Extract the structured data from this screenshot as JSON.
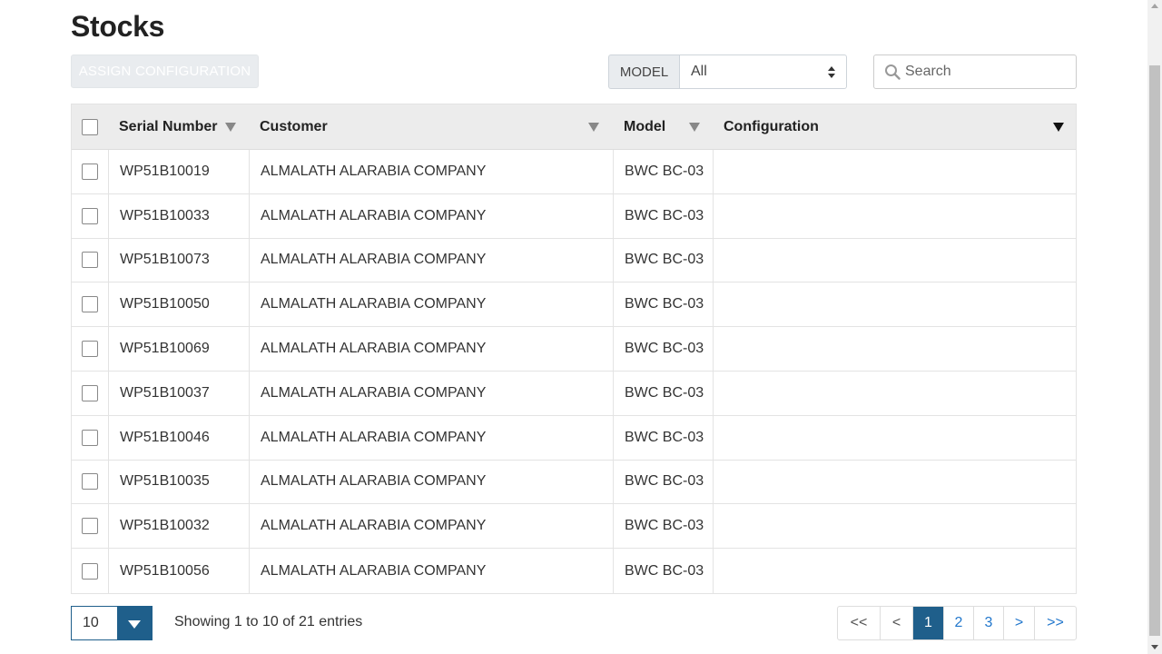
{
  "page": {
    "title": "Stocks"
  },
  "toolbar": {
    "assign_label": "ASSIGN CONFIGURATION",
    "model_label": "MODEL",
    "model_selected": "All",
    "search_placeholder": "Search"
  },
  "table": {
    "headers": [
      "Serial Number",
      "Customer",
      "Model",
      "Configuration"
    ],
    "rows": [
      {
        "serial": "WP51B10019",
        "customer": "ALMALATH ALARABIA COMPANY",
        "model": "BWC BC-03",
        "configuration": ""
      },
      {
        "serial": "WP51B10033",
        "customer": "ALMALATH ALARABIA COMPANY",
        "model": "BWC BC-03",
        "configuration": ""
      },
      {
        "serial": "WP51B10073",
        "customer": "ALMALATH ALARABIA COMPANY",
        "model": "BWC BC-03",
        "configuration": ""
      },
      {
        "serial": "WP51B10050",
        "customer": "ALMALATH ALARABIA COMPANY",
        "model": "BWC BC-03",
        "configuration": ""
      },
      {
        "serial": "WP51B10069",
        "customer": "ALMALATH ALARABIA COMPANY",
        "model": "BWC BC-03",
        "configuration": ""
      },
      {
        "serial": "WP51B10037",
        "customer": "ALMALATH ALARABIA COMPANY",
        "model": "BWC BC-03",
        "configuration": ""
      },
      {
        "serial": "WP51B10046",
        "customer": "ALMALATH ALARABIA COMPANY",
        "model": "BWC BC-03",
        "configuration": ""
      },
      {
        "serial": "WP51B10035",
        "customer": "ALMALATH ALARABIA COMPANY",
        "model": "BWC BC-03",
        "configuration": ""
      },
      {
        "serial": "WP51B10032",
        "customer": "ALMALATH ALARABIA COMPANY",
        "model": "BWC BC-03",
        "configuration": ""
      },
      {
        "serial": "WP51B10056",
        "customer": "ALMALATH ALARABIA COMPANY",
        "model": "BWC BC-03",
        "configuration": ""
      }
    ]
  },
  "footer": {
    "page_size": "10",
    "showing_text": "Showing 1 to 10 of 21 entries",
    "pager": {
      "first": "<<",
      "prev": "<",
      "pages": [
        "1",
        "2",
        "3"
      ],
      "active_page": "1",
      "next": ">",
      "last": ">>"
    }
  },
  "colors": {
    "accent": "#1f5f8b",
    "link": "#2277cc",
    "header_bg": "#ececec"
  }
}
